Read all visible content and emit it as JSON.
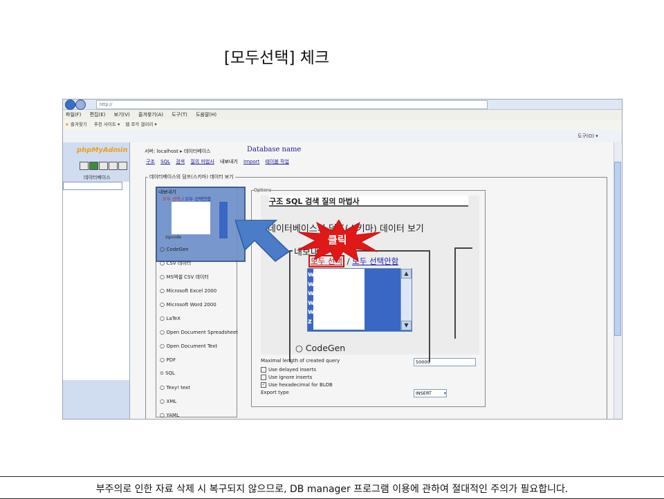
{
  "slide": {
    "title": "[모두선택] 체크",
    "caption": "부주의로 인한 자료 삭제 시 복구되지 않으므로, DB manager 프로그램 이용에 관하여 절대적인 주의가 필요합니다."
  },
  "browser": {
    "url": "http://",
    "menu": [
      "파일(F)",
      "편집(E)",
      "보기(V)",
      "즐겨찾기(A)",
      "도구(T)",
      "도움말(H)"
    ],
    "favorites_label": "즐겨찾기",
    "fav_items": [
      "추천 사이트 ▾",
      "웹 조각 갤러리 ▾"
    ],
    "tools_label": "도구(O) ▾"
  },
  "pma": {
    "logo": "phpMyAdmin",
    "db_label": "데이터베이스",
    "server_crumb": "서버: localhost ▸ 데이터베이스",
    "db_name": "Database name",
    "tabs": [
      "구조",
      "SQL",
      "검색",
      "질의 마법사",
      "내보내기",
      "Import",
      "테이블 작업"
    ],
    "fieldset_legend": "데이터베이스의 덤프(스키마) 데이터 보기",
    "export_legend": "내보내기",
    "select_all": "모두 선택",
    "separator": " / ",
    "unselect_all": "모두 선택안함",
    "list_last": "zipcode",
    "formats": [
      "CodeGen",
      "CSV 데이터",
      "MS엑셀 CSV 데이터",
      "Microsoft Excel 2000",
      "Microsoft Word 2000",
      "LaTeX",
      "Open Document Spreadsheet",
      "Open Document Text",
      "PDF",
      "SQL",
      "Texy! text",
      "XML",
      "YAML"
    ],
    "selected_format": "SQL",
    "options_legend": "Options",
    "max_length_label": "Maximal length of created query",
    "max_length_value": "50000",
    "checkboxes": [
      {
        "label": "Use delayed inserts",
        "checked": false
      },
      {
        "label": "Use ignore inserts",
        "checked": false
      },
      {
        "label": "Use hexadecimal for BLOB",
        "checked": true
      }
    ],
    "export_type_label": "Export type",
    "export_type_value": "INSERT"
  },
  "zoom": {
    "tabs": "구조  SQL  검색  질의 마법사",
    "heading": "데이터베이스의 덤프(스키마) 데이터 보기",
    "legend": "내보내",
    "select_all": "모두 선택",
    "separator": " / ",
    "unselect_all": "모두 선택안함",
    "list_letters": [
      "w",
      "w",
      "w",
      "w",
      "w",
      "z"
    ],
    "codegen": "CodeGen"
  },
  "callout": {
    "label": "클릭"
  }
}
